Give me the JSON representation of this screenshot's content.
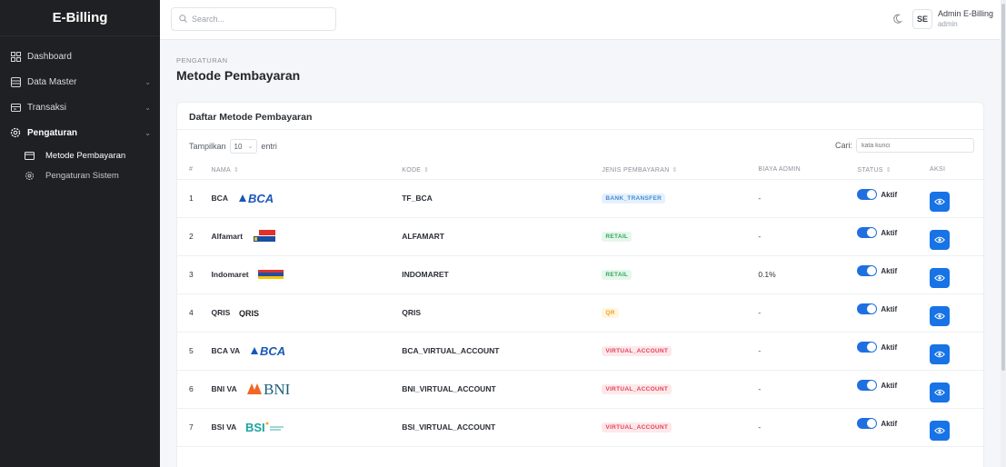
{
  "app": {
    "brand": "E-Billing"
  },
  "sidebar": {
    "items": [
      {
        "label": "Dashboard"
      },
      {
        "label": "Data Master"
      },
      {
        "label": "Transaksi"
      },
      {
        "label": "Pengaturan"
      }
    ],
    "sub_items": [
      {
        "label": "Metode Pembayaran"
      },
      {
        "label": "Pengaturan Sistem"
      }
    ]
  },
  "topbar": {
    "search_placeholder": "Search...",
    "avatar_initials": "SE",
    "user_name": "Admin E-Billing",
    "user_role": "admin"
  },
  "header": {
    "breadcrumb": "PENGATURAN",
    "title": "Metode Pembayaran"
  },
  "card": {
    "title": "Daftar Metode Pembayaran",
    "show_prefix": "Tampilkan",
    "entries_value": "10",
    "show_suffix": "entri",
    "search_label": "Cari:",
    "search_placeholder": "kata kunci"
  },
  "table": {
    "headers": [
      "#",
      "NAMA",
      "KODE",
      "JENIS PEMBAYARAN",
      "BIAYA ADMIN",
      "STATUS",
      "AKSI"
    ],
    "rows": [
      {
        "no": "1",
        "nama": "BCA",
        "logo": "BCA",
        "kode": "TF_BCA",
        "jenis": "BANK_TRANSFER",
        "badge": "bank",
        "biaya": "-",
        "status": "Aktif"
      },
      {
        "no": "2",
        "nama": "Alfamart",
        "logo": "alfamart",
        "kode": "ALFAMART",
        "jenis": "RETAIL",
        "badge": "retail",
        "biaya": "-",
        "status": "Aktif"
      },
      {
        "no": "3",
        "nama": "Indomaret",
        "logo": "indomaret",
        "kode": "INDOMARET",
        "jenis": "RETAIL",
        "badge": "retail",
        "biaya": "0.1%",
        "status": "Aktif"
      },
      {
        "no": "4",
        "nama": "QRIS",
        "logo": "QRIS",
        "kode": "QRIS",
        "jenis": "QR",
        "badge": "qr",
        "biaya": "-",
        "status": "Aktif"
      },
      {
        "no": "5",
        "nama": "BCA VA",
        "logo": "BCA",
        "kode": "BCA_VIRTUAL_ACCOUNT",
        "jenis": "VIRTUAL_ACCOUNT",
        "badge": "va",
        "biaya": "-",
        "status": "Aktif"
      },
      {
        "no": "6",
        "nama": "BNI VA",
        "logo": "BNI",
        "kode": "BNI_VIRTUAL_ACCOUNT",
        "jenis": "VIRTUAL_ACCOUNT",
        "badge": "va",
        "biaya": "-",
        "status": "Aktif"
      },
      {
        "no": "7",
        "nama": "BSI VA",
        "logo": "BSI",
        "kode": "BSI_VIRTUAL_ACCOUNT",
        "jenis": "VIRTUAL_ACCOUNT",
        "badge": "va",
        "biaya": "-",
        "status": "Aktif"
      }
    ]
  },
  "colors": {
    "sidebar": "#1f2023",
    "primary": "#1773e6",
    "bank": "#3f8cd6",
    "retail": "#31a75b",
    "qr": "#f0a020",
    "va": "#e2435a"
  }
}
